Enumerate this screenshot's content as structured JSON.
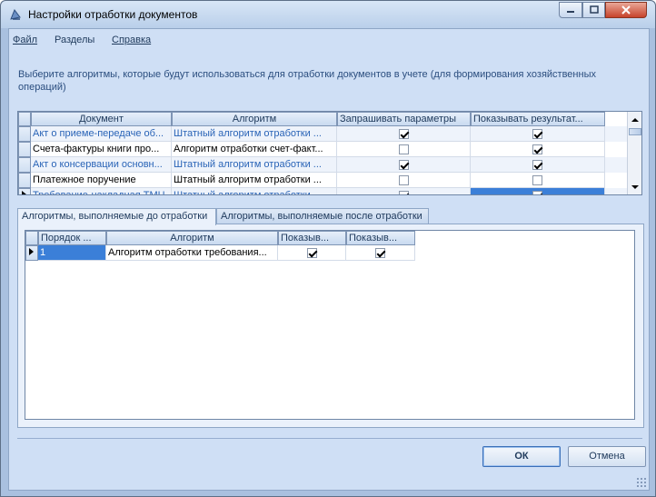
{
  "window": {
    "title": "Настройки отработки документов",
    "icon": "app-pen-icon"
  },
  "menu": {
    "file": "Файл",
    "sections": "Разделы",
    "help": "Справка"
  },
  "instructions": "Выберите алгоритмы, которые будут использоваться для отработки документов в учете (для формирования хозяйственных операций)",
  "documents_grid": {
    "columns": [
      "Документ",
      "Алгоритм",
      "Запрашивать параметры",
      "Показывать результат..."
    ],
    "rows": [
      {
        "document": "Акт о приеме-передаче об...",
        "algorithm": "Штатный алгоритм отработки ...",
        "ask_params": true,
        "show_result": true
      },
      {
        "document": "Счета-фактуры книги про...",
        "algorithm": "Алгоритм отработки счет-факт...",
        "ask_params": false,
        "show_result": true
      },
      {
        "document": "Акт о консервации основн...",
        "algorithm": "Штатный алгоритм отработки ...",
        "ask_params": true,
        "show_result": true
      },
      {
        "document": "Платежное поручение",
        "algorithm": "Штатный алгоритм отработки ...",
        "ask_params": false,
        "show_result": false
      },
      {
        "document": "Требование-накладная ТМЦ",
        "algorithm": "Штатный алгоритм отработки ...",
        "ask_params": true,
        "show_result": true
      }
    ]
  },
  "tabs": {
    "before": "Алгоритмы, выполняемые до отработки",
    "after": "Алгоритмы, выполняемые после отработки"
  },
  "algorithms_grid": {
    "columns": [
      "Порядок ...",
      "Алгоритм",
      "Показыв...",
      "Показыв..."
    ],
    "rows": [
      {
        "order": "1",
        "algorithm": "Алгоритм отработки требования...",
        "c1": true,
        "c2": true
      }
    ]
  },
  "buttons": {
    "ok": "ОК",
    "cancel": "Отмена"
  }
}
